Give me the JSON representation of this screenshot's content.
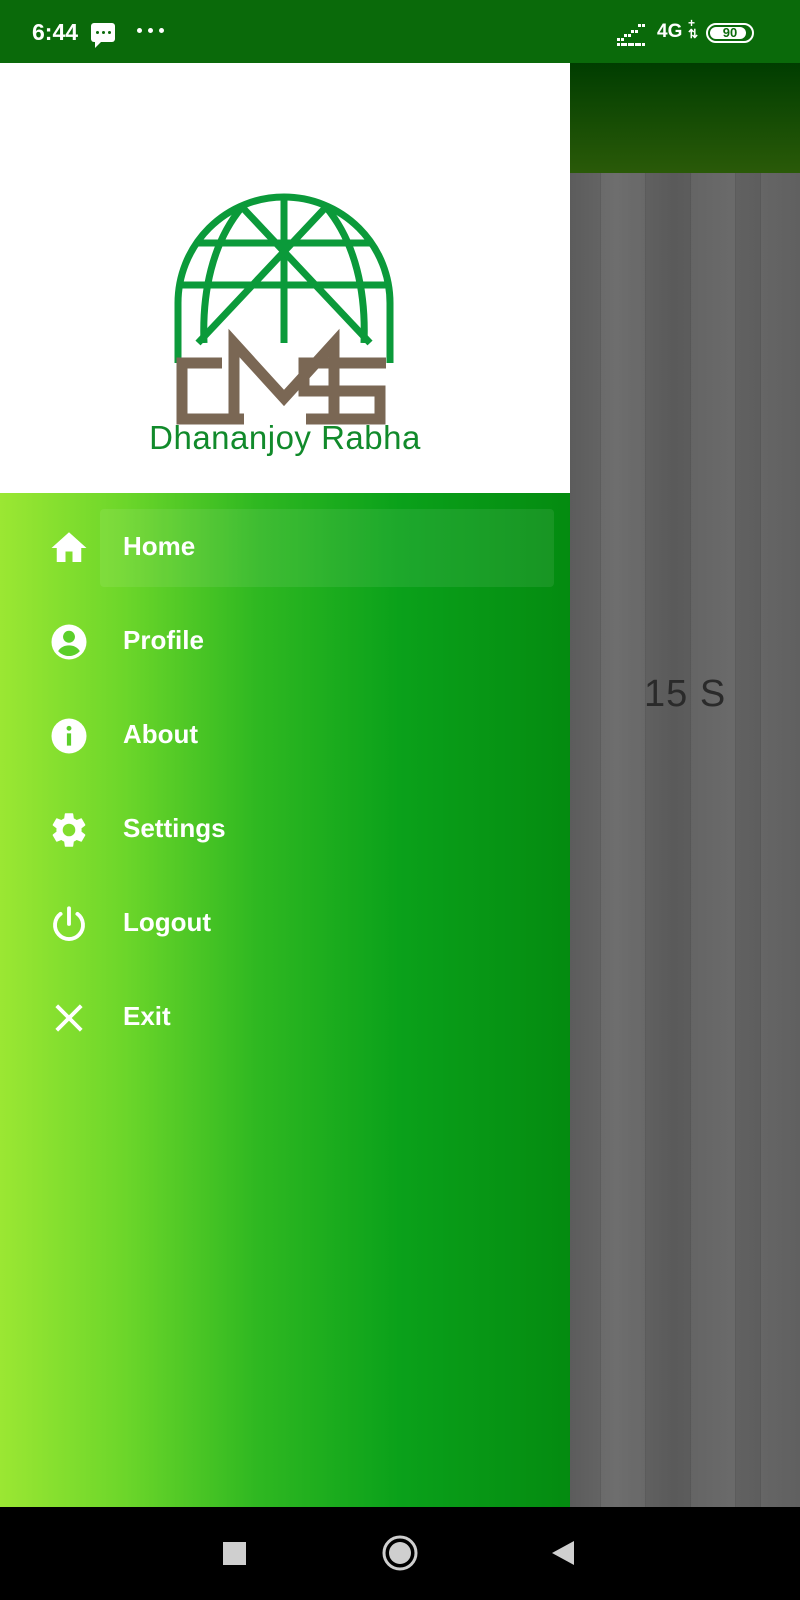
{
  "status_bar": {
    "time": "6:44",
    "network": "4G",
    "network_arrows": "+\n⇅",
    "battery_level": "90",
    "icons": [
      "message-icon",
      "more-dots-icon",
      "signal-icon",
      "battery-icon"
    ]
  },
  "drawer": {
    "user_name": "Dhananjoy Rabha",
    "items": [
      {
        "label": "Home",
        "icon": "home-icon",
        "active": true
      },
      {
        "label": "Profile",
        "icon": "account-circle-icon",
        "active": false
      },
      {
        "label": "About",
        "icon": "info-icon",
        "active": false
      },
      {
        "label": "Settings",
        "icon": "gear-icon",
        "active": false
      },
      {
        "label": "Logout",
        "icon": "power-icon",
        "active": false
      },
      {
        "label": "Exit",
        "icon": "close-icon",
        "active": false
      }
    ]
  },
  "background_app": {
    "timer_text": "15 S"
  },
  "nav_bar": {
    "icons": [
      "recent-apps-icon",
      "home-circle-icon",
      "back-icon"
    ]
  },
  "colors": {
    "status_bar": "#0a6a0a",
    "brand_green": "#118a2b",
    "logo_green": "#0b9a3a",
    "logo_brown": "#7a6754",
    "drawer_gradient_start": "#9be733",
    "drawer_gradient_end": "#048b10"
  }
}
